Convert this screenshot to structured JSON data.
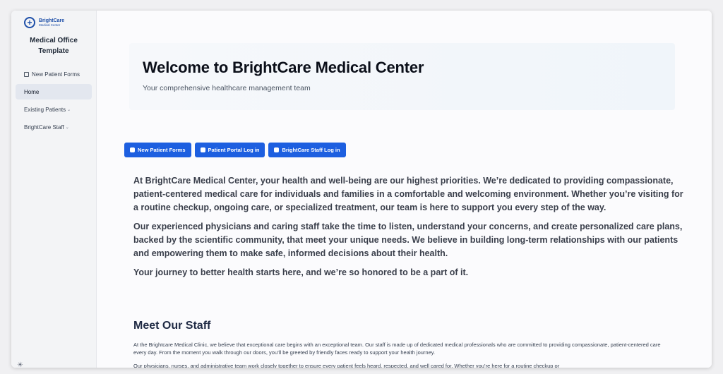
{
  "logo": {
    "name": "BrightCare",
    "sub": "Medical Center"
  },
  "sidebar": {
    "title": "Medical Office Template",
    "items": [
      {
        "label": "New Patient Forms",
        "icon": "form-icon"
      },
      {
        "label": "Home"
      },
      {
        "label": "Existing Patients",
        "chevron": "⌄"
      },
      {
        "label": "BrightCare Staff",
        "chevron": "⌄"
      }
    ],
    "theme_toggle": "☀"
  },
  "hero": {
    "title": "Welcome to BrightCare Medical Center",
    "subtitle": "Your comprehensive healthcare management team"
  },
  "buttons": [
    {
      "label": "New Patient Forms",
      "icon": "heart-icon"
    },
    {
      "label": "Patient Portal Log in",
      "icon": "building-icon"
    },
    {
      "label": "BrightCare Staff Log in",
      "icon": "stethoscope-icon"
    }
  ],
  "intro": [
    "At BrightCare Medical Center, your health and well-being are our highest priorities. We’re dedicated to providing compassionate, patient-centered medical care for individuals and families in a comfortable and welcoming environment. Whether you’re visiting for a routine checkup, ongoing care, or specialized treatment, our team is here to support you every step of the way.",
    "Our experienced physicians and caring staff take the time to listen, understand your concerns, and create personalized care plans, backed by the scientific community, that meet your unique needs. We believe in building long-term relationships with our patients and empowering them to make safe,  informed decisions about their health.",
    "Your journey to better health starts here, and we’re so honored to be a part of it."
  ],
  "staff": {
    "heading": "Meet Our Staff",
    "paragraph1": "At the Brightcare Medical Clinic, we believe that exceptional care begins with an exceptional team. Our staff is made up of dedicated medical professionals who are committed to providing compassionate, patient-centered care every day. From the moment you walk through our doors, you’ll be greeted by friendly faces ready to support your health journey.",
    "paragraph2": "Our physicians, nurses, and administrative team work closely together to ensure every patient feels heard, respected, and well cared for. Whether you’re here for a routine checkup or"
  },
  "colors": {
    "primary": "#1d5fe0",
    "brand": "#1e4fa8"
  }
}
